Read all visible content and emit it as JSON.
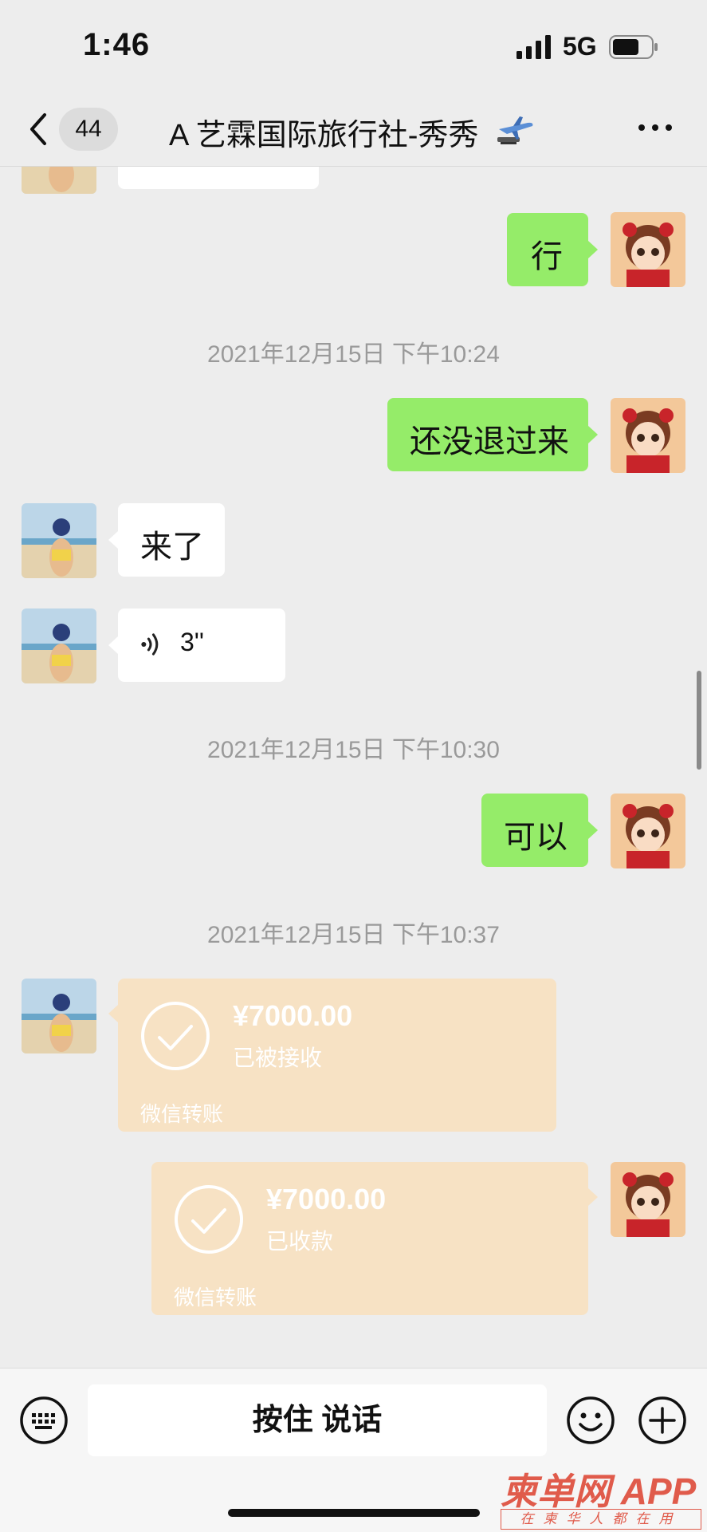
{
  "status_bar": {
    "time": "1:46",
    "network": "5G"
  },
  "nav": {
    "unread_count": "44",
    "title": "A 艺霖国际旅行社-秀秀",
    "title_emoji_icon": "airplane-icon"
  },
  "messages": [
    {
      "sender": "me",
      "text": "行"
    },
    {
      "timestamp": "2021年12月15日 下午10:24"
    },
    {
      "sender": "me",
      "text": "还没退过来"
    },
    {
      "sender": "other",
      "text": "来了"
    },
    {
      "sender": "other",
      "voice_duration": "3''"
    },
    {
      "timestamp": "2021年12月15日 下午10:30"
    },
    {
      "sender": "me",
      "text": "可以"
    },
    {
      "timestamp": "2021年12月15日 下午10:37"
    },
    {
      "sender": "other",
      "transfer_amount": "¥7000.00",
      "transfer_status": "已被接收",
      "transfer_label": "微信转账"
    },
    {
      "sender": "me",
      "transfer_amount": "¥7000.00",
      "transfer_status": "已收款",
      "transfer_label": "微信转账"
    }
  ],
  "input": {
    "hold_to_talk": "按住 说话"
  },
  "watermark": {
    "brand": "柬单网",
    "suffix": "APP",
    "slogan": "在柬华人都在用"
  },
  "colors": {
    "background": "#ededed",
    "my_bubble": "#95ec69",
    "their_bubble": "#ffffff",
    "transfer": "#f7e2c4",
    "watermark": "#e05b4b"
  }
}
